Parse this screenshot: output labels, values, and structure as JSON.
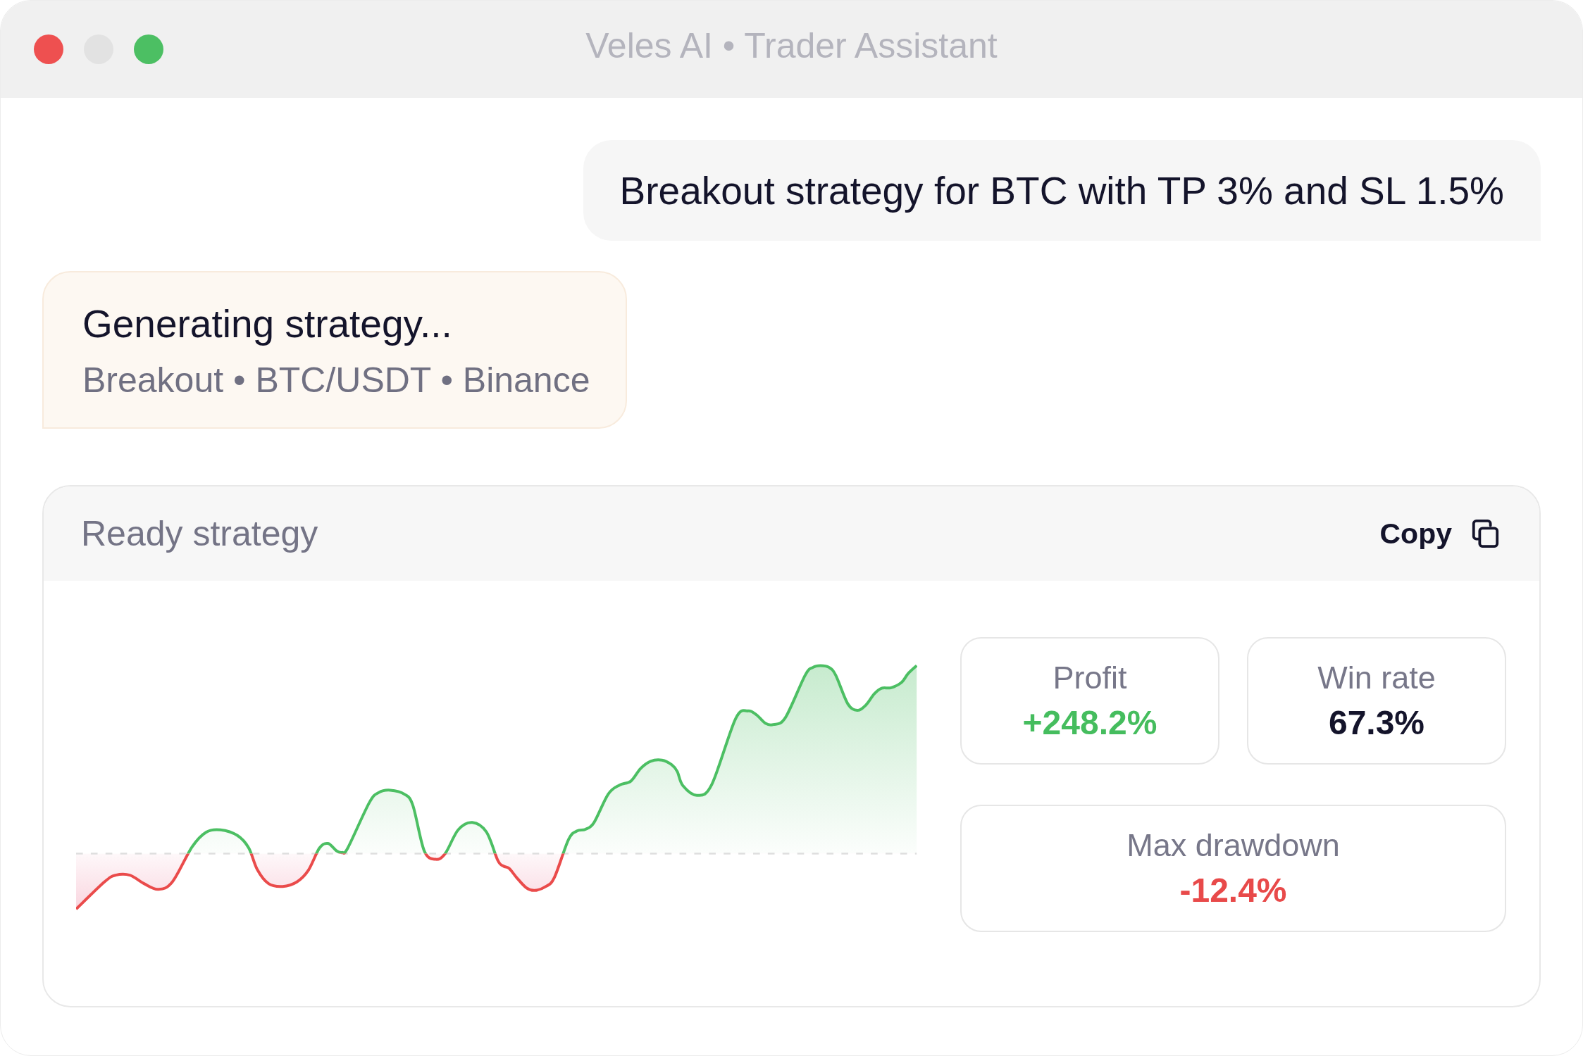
{
  "window": {
    "title": "Veles AI • Trader Assistant",
    "window_buttons": [
      {
        "kind": "close",
        "disabled": false
      },
      {
        "kind": "minimize",
        "disabled": true
      },
      {
        "kind": "zoom",
        "disabled": false
      }
    ]
  },
  "messages": [
    {
      "kind": "user",
      "text": "Breakout strategy for BTC with TP 3% and SL 1.5%"
    },
    {
      "kind": "status",
      "title": "Generating strategy...",
      "subtitle": "Breakout • BTC/USDT • Binance"
    }
  ],
  "strategy_card": {
    "title": "Ready strategy",
    "copy_button": {
      "label": "Copy"
    },
    "stats": [
      {
        "label": "Profit",
        "value": "+248.2%",
        "color": "#45bd5e"
      },
      {
        "label": "Win rate",
        "value": "67.3%",
        "color": "#14142b"
      },
      {
        "label": "Max drawdown",
        "value": "-12.4%",
        "color": "#e84a4a"
      }
    ]
  }
}
